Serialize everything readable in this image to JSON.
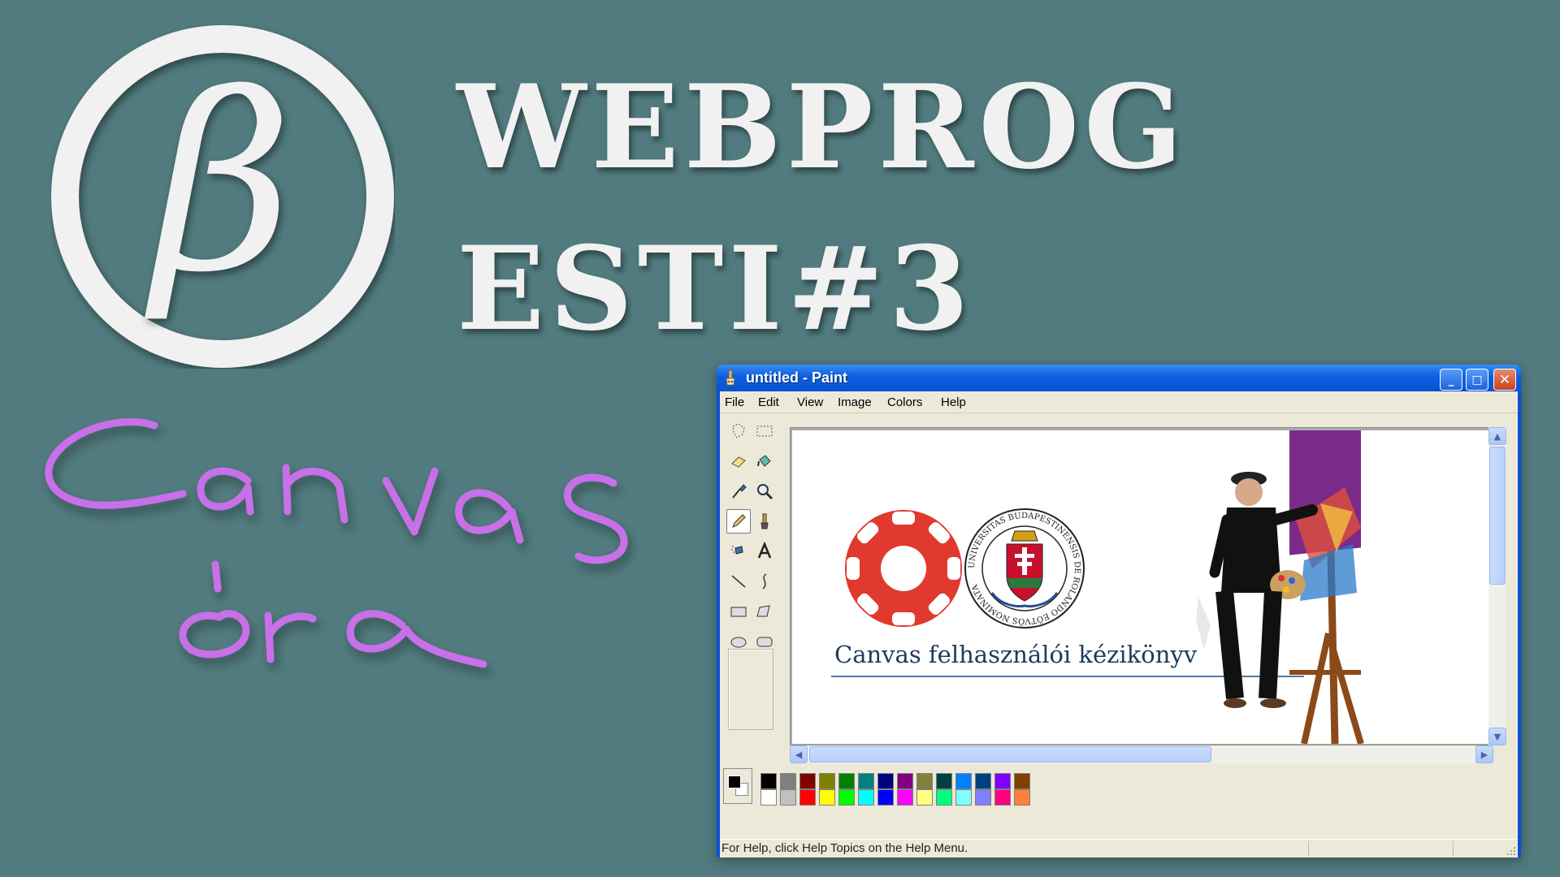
{
  "thumbnail": {
    "logo": {
      "symbol": "β"
    },
    "title_lines": [
      "WEBPROG",
      "ESTI#3"
    ],
    "handwriting": [
      "Canvas",
      "óra"
    ],
    "colors": {
      "background": "#517b7e",
      "title": "#f1f1f1",
      "handwriting": "#c86fe8"
    }
  },
  "paint": {
    "title": "untitled - Paint",
    "window_buttons": {
      "minimize": "_",
      "maximize": "□",
      "close": "✕"
    },
    "menu": [
      "File",
      "Edit",
      "View",
      "Image",
      "Colors",
      "Help"
    ],
    "tools": [
      "free-form-select",
      "select",
      "eraser",
      "fill-with-color",
      "pick-color",
      "magnifier",
      "pencil",
      "brush",
      "airbrush",
      "text",
      "line",
      "curve",
      "rectangle",
      "polygon",
      "ellipse",
      "rounded-rectangle"
    ],
    "selected_tool": "pencil",
    "canvas": {
      "caption": "Canvas felhasználói kézikönyv",
      "seal_text": "UNIVERSITAS BUDAPESTINENSIS DE ROLANDO EÖTVÖS NOMINATA",
      "accent": "#e03a2f"
    },
    "palette": {
      "top": [
        "#000000",
        "#808080",
        "#800000",
        "#808000",
        "#008000",
        "#008080",
        "#000080",
        "#800080",
        "#808040",
        "#004040",
        "#0080ff",
        "#004080",
        "#8000ff",
        "#804000"
      ],
      "bottom": [
        "#ffffff",
        "#c0c0c0",
        "#ff0000",
        "#ffff00",
        "#00ff00",
        "#00ffff",
        "#0000ff",
        "#ff00ff",
        "#ffff80",
        "#00ff80",
        "#80ffff",
        "#8080ff",
        "#ff0080",
        "#ff8040"
      ],
      "foreground": "#000000",
      "background": "#ffffff"
    },
    "status": "For Help, click Help Topics on the Help Menu."
  }
}
